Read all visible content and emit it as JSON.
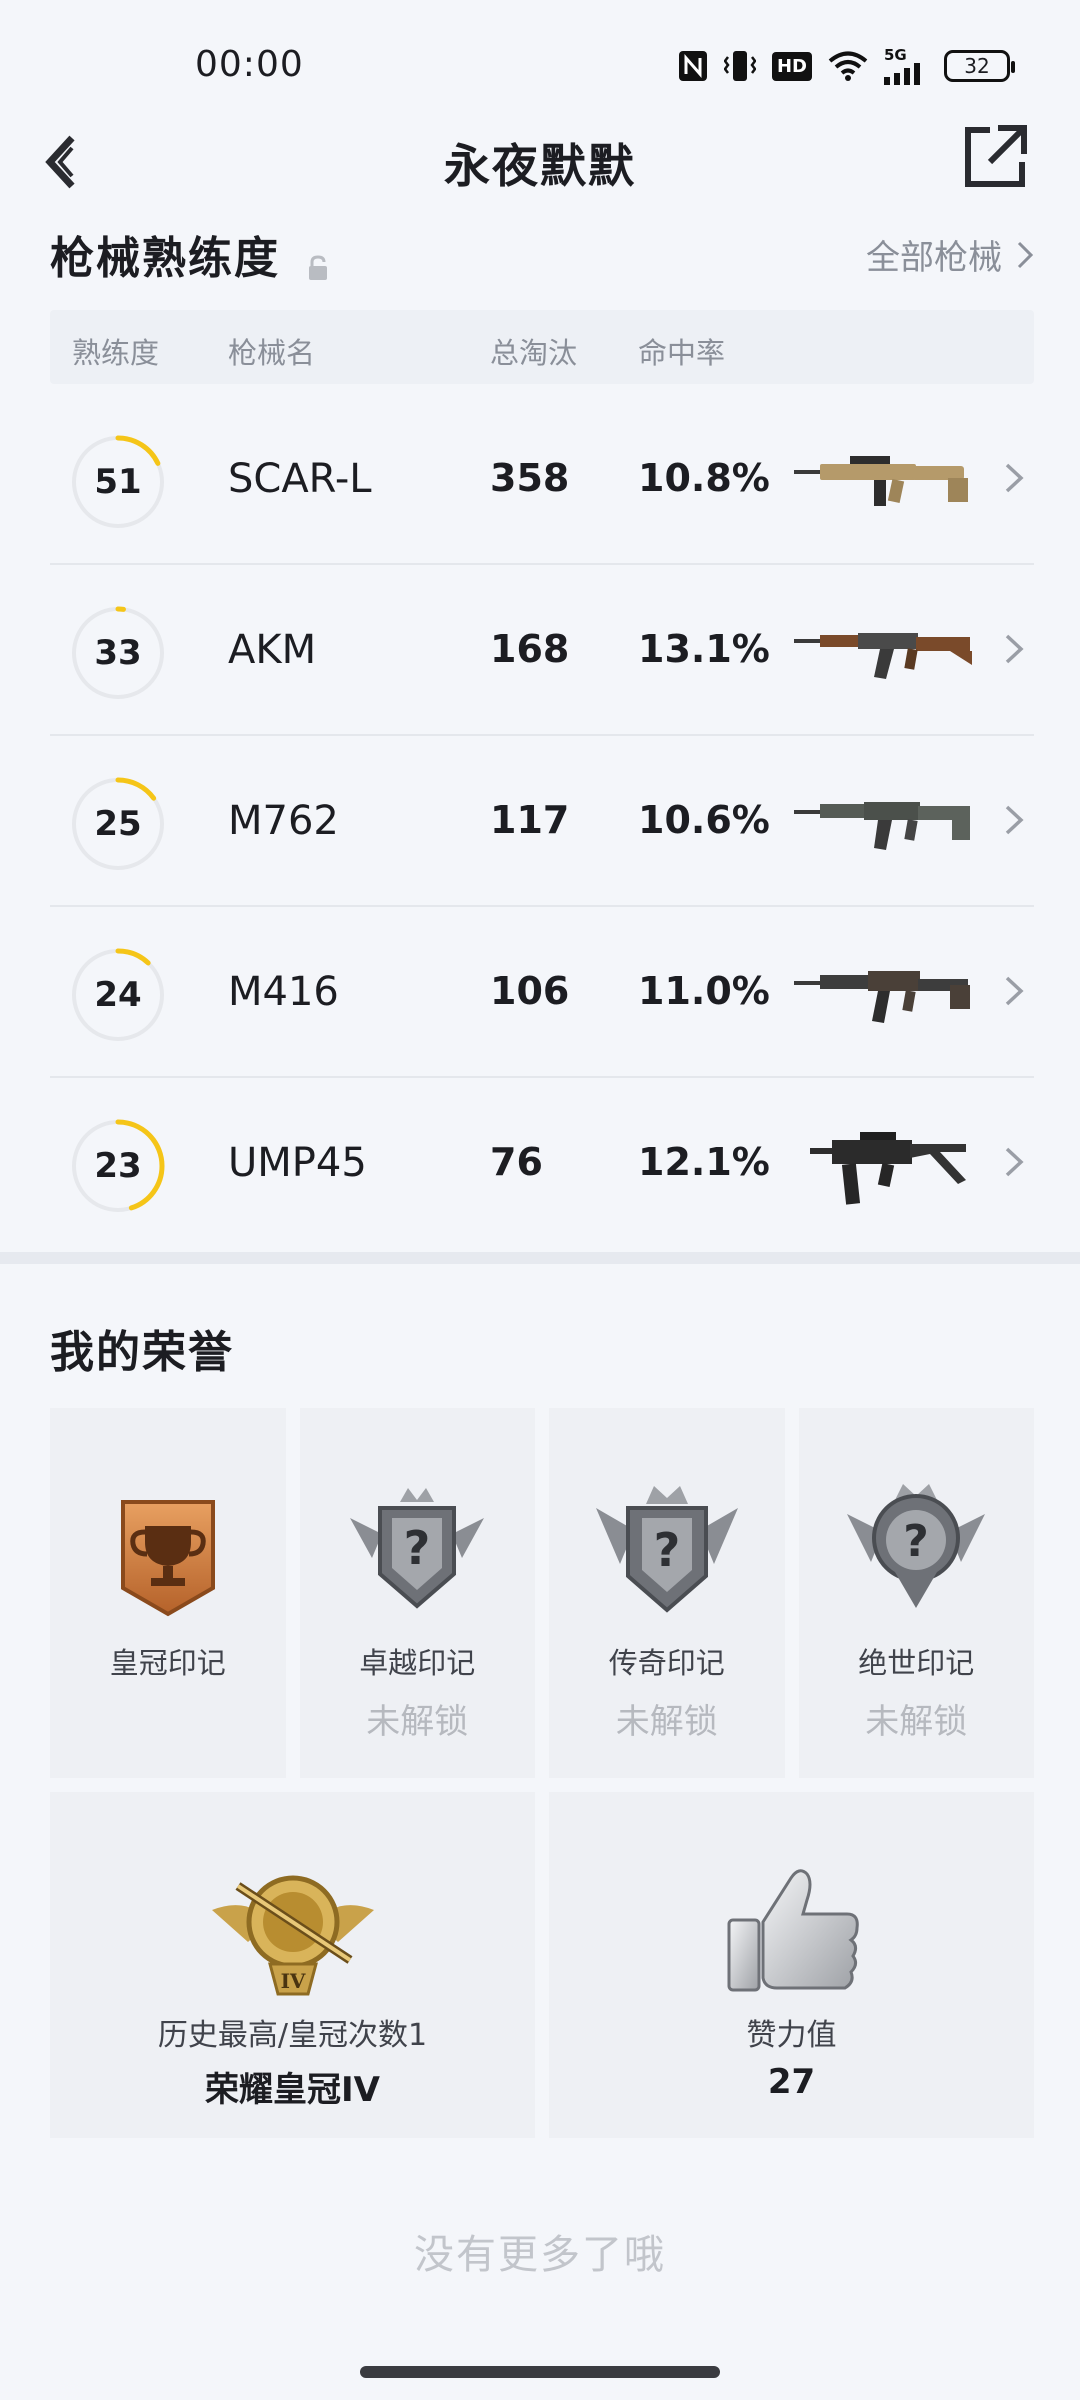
{
  "status_bar": {
    "time": "00:00",
    "battery": "32",
    "network": "5G",
    "hd": "HD",
    "icons": [
      "nfc-icon",
      "vibrate-icon",
      "hd-icon",
      "wifi-icon",
      "signal-icon",
      "battery-icon"
    ]
  },
  "header": {
    "title": "永夜默默",
    "back_icon": "back-arrow-icon",
    "share_icon": "share-icon"
  },
  "gun_section": {
    "title": "枪械熟练度",
    "lock_icon": "lock-icon",
    "all_link": "全部枪械",
    "columns": [
      "熟练度",
      "枪械名",
      "总淘汰",
      "命中率"
    ],
    "rows": [
      {
        "level": "51",
        "progress": 0.18,
        "name": "SCAR-L",
        "kills": "358",
        "accuracy": "10.8%",
        "icon": "rifle-scar-icon"
      },
      {
        "level": "33",
        "progress": 0.02,
        "name": "AKM",
        "kills": "168",
        "accuracy": "13.1%",
        "icon": "rifle-akm-icon"
      },
      {
        "level": "25",
        "progress": 0.15,
        "name": "M762",
        "kills": "117",
        "accuracy": "10.6%",
        "icon": "rifle-m762-icon"
      },
      {
        "level": "24",
        "progress": 0.12,
        "name": "M416",
        "kills": "106",
        "accuracy": "11.0%",
        "icon": "rifle-m416-icon"
      },
      {
        "level": "23",
        "progress": 0.45,
        "name": "UMP45",
        "kills": "76",
        "accuracy": "12.1%",
        "icon": "smg-ump-icon"
      }
    ],
    "accent_color": "#f5c518"
  },
  "honors": {
    "title": "我的荣誉",
    "badges": [
      {
        "name": "皇冠印记",
        "status": "",
        "icon": "trophy-badge-icon",
        "unlocked": true
      },
      {
        "name": "卓越印记",
        "status": "未解锁",
        "icon": "locked-badge-icon",
        "unlocked": false
      },
      {
        "name": "传奇印记",
        "status": "未解锁",
        "icon": "locked-badge-icon",
        "unlocked": false
      },
      {
        "name": "绝世印记",
        "status": "未解锁",
        "icon": "locked-badge-icon",
        "unlocked": false
      }
    ],
    "stats": [
      {
        "label": "历史最高/皇冠次数1",
        "value": "荣耀皇冠IV",
        "icon": "crown-rank-iv-icon"
      },
      {
        "label": "赞力值",
        "value": "27",
        "icon": "thumbs-up-icon"
      }
    ],
    "rank_badge_text": "IV"
  },
  "footer": {
    "note": "没有更多了哦"
  }
}
